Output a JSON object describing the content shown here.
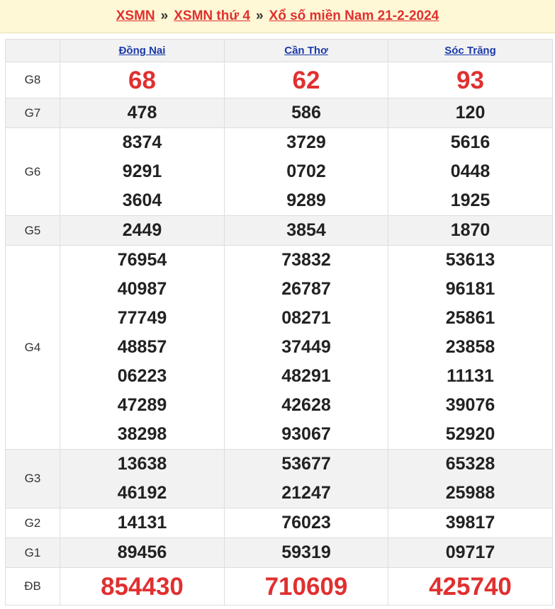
{
  "breadcrumb": {
    "home": "XSMN",
    "day": "XSMN thứ 4",
    "current": "Xổ số miền Nam 21-2-2024",
    "separator": "»"
  },
  "provinces": [
    "Đồng Nai",
    "Cần Thơ",
    "Sóc Trăng"
  ],
  "prizes": [
    {
      "label": "G8",
      "values": [
        [
          "68"
        ],
        [
          "62"
        ],
        [
          "93"
        ]
      ]
    },
    {
      "label": "G7",
      "values": [
        [
          "478"
        ],
        [
          "586"
        ],
        [
          "120"
        ]
      ]
    },
    {
      "label": "G6",
      "values": [
        [
          "8374",
          "9291",
          "3604"
        ],
        [
          "3729",
          "0702",
          "9289"
        ],
        [
          "5616",
          "0448",
          "1925"
        ]
      ]
    },
    {
      "label": "G5",
      "values": [
        [
          "2449"
        ],
        [
          "3854"
        ],
        [
          "1870"
        ]
      ]
    },
    {
      "label": "G4",
      "values": [
        [
          "76954",
          "40987",
          "77749",
          "48857",
          "06223",
          "47289",
          "38298"
        ],
        [
          "73832",
          "26787",
          "08271",
          "37449",
          "48291",
          "42628",
          "93067"
        ],
        [
          "53613",
          "96181",
          "25861",
          "23858",
          "11131",
          "39076",
          "52920"
        ]
      ]
    },
    {
      "label": "G3",
      "values": [
        [
          "13638",
          "46192"
        ],
        [
          "53677",
          "21247"
        ],
        [
          "65328",
          "25988"
        ]
      ]
    },
    {
      "label": "G2",
      "values": [
        [
          "14131"
        ],
        [
          "76023"
        ],
        [
          "39817"
        ]
      ]
    },
    {
      "label": "G1",
      "values": [
        [
          "89456"
        ],
        [
          "59319"
        ],
        [
          "09717"
        ]
      ]
    },
    {
      "label": "ĐB",
      "values": [
        [
          "854430"
        ],
        [
          "710609"
        ],
        [
          "425740"
        ]
      ]
    }
  ],
  "colors": {
    "accent": "#e03030",
    "link": "#1a3aa8",
    "header_bg": "#fff8d6",
    "row_shade": "#f2f2f2"
  }
}
